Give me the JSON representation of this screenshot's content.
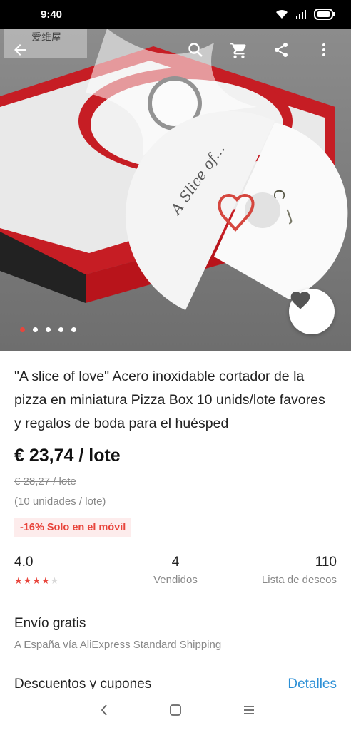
{
  "status_bar": {
    "time": "9:40"
  },
  "watermark": {
    "text": "爱维屋"
  },
  "icons": {
    "back": "back-arrow-icon",
    "search": "search-icon",
    "cart": "cart-icon",
    "share": "share-icon",
    "more": "more-vertical-icon",
    "favorite": "heart-icon"
  },
  "gallery": {
    "image_count": 5,
    "active_index": 0
  },
  "product": {
    "title": "\"A slice of love\" Acero inoxidable cortador de la pizza en miniatura Pizza Box 10 unids/lote favores y regalos de boda para el huésped",
    "price": "€ 23,74 / lote",
    "old_price": "€ 28,27 / lote",
    "units": "(10 unidades / lote)",
    "promo": "-16% Solo en el móvil"
  },
  "stats": {
    "rating": "4.0",
    "rating_stars": 4,
    "sold_value": "4",
    "sold_label": "Vendidos",
    "wishlist_value": "110",
    "wishlist_label": "Lista de deseos"
  },
  "shipping": {
    "title": "Envío gratis",
    "subtitle": "A España vía AliExpress Standard Shipping"
  },
  "discounts": {
    "title": "Descuentos y cupones",
    "link": "Detalles"
  },
  "colors": {
    "accent": "#e8453c",
    "link": "#2b8fd6"
  }
}
